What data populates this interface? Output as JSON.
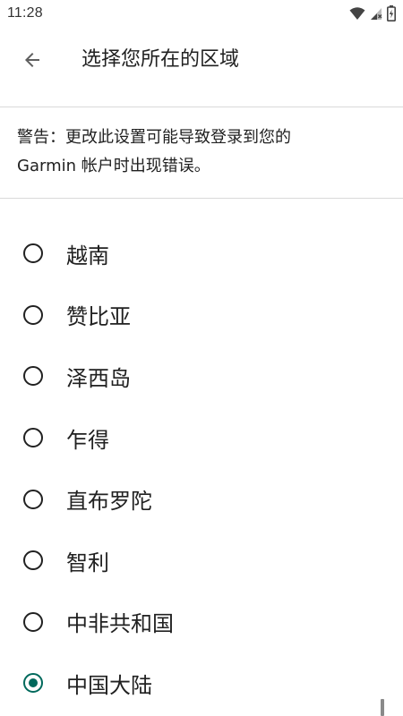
{
  "status_bar": {
    "time": "11:28",
    "icons": [
      "wifi-icon",
      "cellular-signal-icon",
      "battery-charging-icon"
    ]
  },
  "app_bar": {
    "back_icon": "arrow-back-icon",
    "title": "选择您所在的区域"
  },
  "warning": {
    "line1": "警告：更改此设置可能导致登录到您的",
    "line2": "Garmin 帐户时出现错误。"
  },
  "regions": [
    {
      "label": "越南",
      "selected": false
    },
    {
      "label": "赞比亚",
      "selected": false
    },
    {
      "label": "泽西岛",
      "selected": false
    },
    {
      "label": "乍得",
      "selected": false
    },
    {
      "label": "直布罗陀",
      "selected": false
    },
    {
      "label": "智利",
      "selected": false
    },
    {
      "label": "中非共和国",
      "selected": false
    },
    {
      "label": "中国大陆",
      "selected": true
    }
  ],
  "colors": {
    "accent": "#00695c",
    "text": "#212121",
    "divider": "#d9d9d9"
  }
}
